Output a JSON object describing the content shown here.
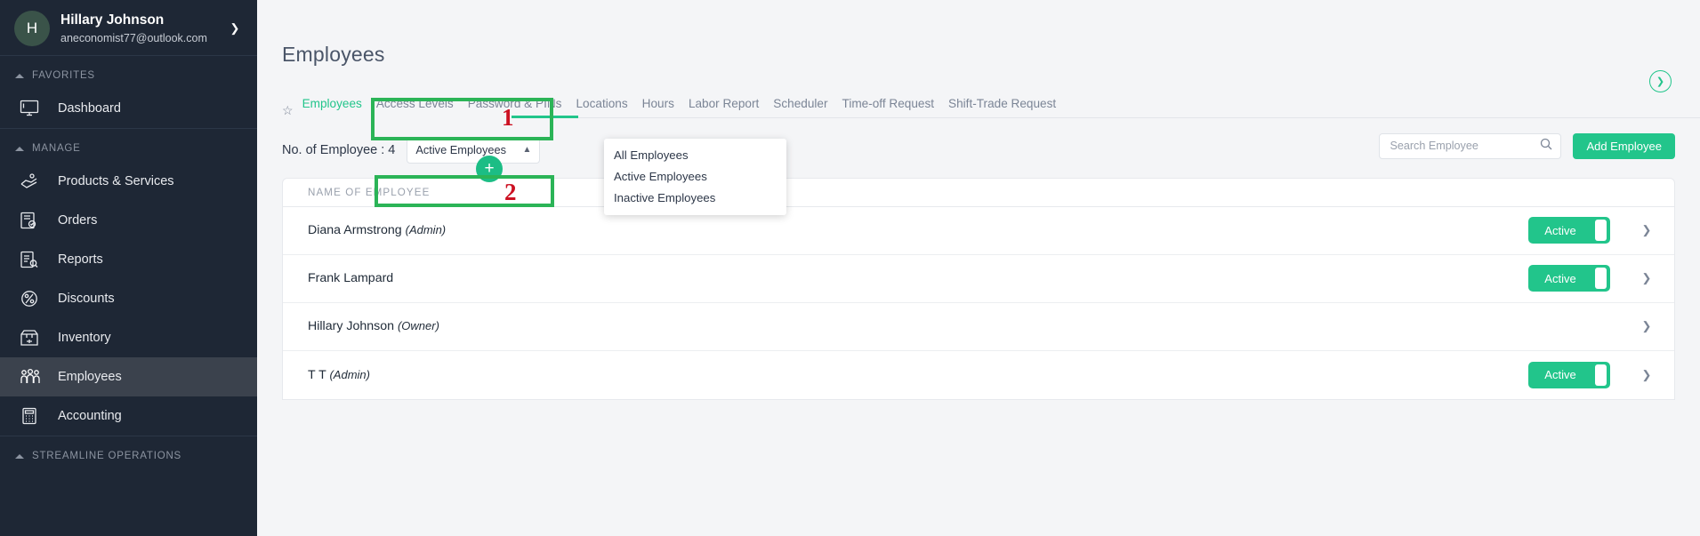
{
  "sidebar": {
    "profile": {
      "avatar_initial": "H",
      "name": "Hillary Johnson",
      "email": "aneconomist77@outlook.com",
      "caret_icon": "chevron-down-icon"
    },
    "groups": [
      {
        "label": "FAVORITES",
        "items": [
          {
            "label": "Dashboard",
            "icon": "monitor-icon",
            "active": false
          }
        ]
      },
      {
        "label": "MANAGE",
        "items": [
          {
            "label": "Products & Services",
            "icon": "products-icon",
            "active": false
          },
          {
            "label": "Orders",
            "icon": "orders-icon",
            "active": false
          },
          {
            "label": "Reports",
            "icon": "reports-icon",
            "active": false
          },
          {
            "label": "Discounts",
            "icon": "percent-badge-icon",
            "active": false
          },
          {
            "label": "Inventory",
            "icon": "inventory-box-icon",
            "active": false
          },
          {
            "label": "Employees",
            "icon": "people-icon",
            "active": true
          },
          {
            "label": "Accounting",
            "icon": "calculator-icon",
            "active": false
          }
        ]
      },
      {
        "label": "STREAMLINE OPERATIONS",
        "items": []
      }
    ]
  },
  "main": {
    "page_title": "Employees",
    "star_icon": "star-outline-icon",
    "tabs": [
      {
        "label": "Employees",
        "selected": true
      },
      {
        "label": "Access Levels",
        "selected": false
      },
      {
        "label": "Password & PINs",
        "selected": false
      },
      {
        "label": "Locations",
        "selected": false
      },
      {
        "label": "Hours",
        "selected": false
      },
      {
        "label": "Labor Report",
        "selected": false
      },
      {
        "label": "Scheduler",
        "selected": false
      },
      {
        "label": "Time-off Request",
        "selected": false
      },
      {
        "label": "Shift-Trade Request",
        "selected": false
      }
    ],
    "collapse_icon": "chevron-down-circle-icon",
    "toolbar": {
      "employee_count_label": "No. of Employee : 4",
      "filter_value": "Active Employees",
      "filter_caret_icon": "chevron-up-icon",
      "search_placeholder": "Search Employee",
      "search_value": "",
      "search_icon": "search-icon",
      "add_button_label": "Add Employee",
      "add_icon": "plus-icon"
    },
    "dropdown_options": [
      "All Employees",
      "Active Employees",
      "Inactive Employees"
    ],
    "table": {
      "headers": [
        "NAME OF EMPLOYEE"
      ],
      "rows": [
        {
          "name": "Diana Armstrong",
          "role": "(Admin)",
          "status": "Active",
          "has_toggle": true,
          "caret_icon": "chevron-down-icon"
        },
        {
          "name": "Frank Lampard",
          "role": "",
          "status": "Active",
          "has_toggle": true,
          "caret_icon": "chevron-down-icon"
        },
        {
          "name": "Hillary Johnson",
          "role": "(Owner)",
          "status": "",
          "has_toggle": false,
          "caret_icon": "chevron-down-icon"
        },
        {
          "name": "T T",
          "role": "(Admin)",
          "status": "Active",
          "has_toggle": true,
          "caret_icon": "chevron-down-icon"
        }
      ]
    }
  },
  "annotations": [
    {
      "number": "1",
      "target": "filter-select"
    },
    {
      "number": "2",
      "target": "dropdown-option-inactive-employees"
    }
  ],
  "colors": {
    "accent_green": "#22c58b",
    "sidebar_bg": "#1e2735",
    "annotation_box": "#2bb457",
    "annotation_number": "#cc1122"
  }
}
